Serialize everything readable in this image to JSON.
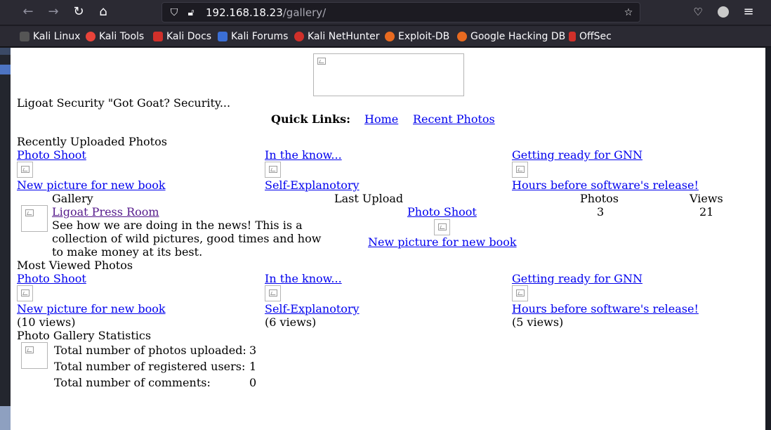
{
  "browser": {
    "url_host": "192.168.18.23",
    "url_path": "/gallery/",
    "bookmarks": [
      {
        "label": "Kali Linux",
        "color": "#3b6fd6"
      },
      {
        "label": "Kali Tools",
        "color": "#e8433a"
      },
      {
        "label": "Kali Docs",
        "color": "#d0302a"
      },
      {
        "label": "Kali Forums",
        "color": "#3b6fd6"
      },
      {
        "label": "Kali NetHunter",
        "color": "#d0302a"
      },
      {
        "label": "Exploit-DB",
        "color": "#e86a20"
      },
      {
        "label": "Google Hacking DB",
        "color": "#e86a20"
      },
      {
        "label": "OffSec",
        "color": "#d0302a"
      }
    ]
  },
  "page": {
    "site_title": "Ligoat Security \"Got Goat? Security...",
    "quick_links_label": "Quick Links:",
    "quick_links": [
      "Home",
      "Recent Photos"
    ],
    "recent_heading": "Recently Uploaded Photos",
    "recent": [
      {
        "album": "Photo Shoot",
        "photo": "New picture for new book"
      },
      {
        "album": "In the know...",
        "photo": "Self-Explanotory"
      },
      {
        "album": "Getting ready for GNN",
        "photo": "Hours before software's release!"
      }
    ],
    "gallery_table": {
      "headers": [
        "Gallery",
        "Last Upload",
        "Photos",
        "Views"
      ],
      "row": {
        "name": "Ligoat Press Room",
        "description": "See how we are doing in the news! This is a collection of wild pictures, good times and how to make money at its best.",
        "last_album": "Photo Shoot",
        "last_photo": "New picture for new book",
        "photos": "3",
        "views": "21"
      }
    },
    "most_viewed_heading": "Most Viewed Photos",
    "most_viewed": [
      {
        "album": "Photo Shoot",
        "photo": "New picture for new book",
        "views": "(10 views)"
      },
      {
        "album": "In the know...",
        "photo": "Self-Explanotory",
        "views": "(6 views)"
      },
      {
        "album": "Getting ready for GNN",
        "photo": "Hours before software's release!",
        "views": "(5 views)"
      }
    ],
    "stats_heading": "Photo Gallery Statistics",
    "stats": [
      {
        "label": "Total number of photos uploaded:",
        "value": "3"
      },
      {
        "label": "Total number of registered users:",
        "value": "1"
      },
      {
        "label": "Total number of comments:",
        "value": "0"
      }
    ]
  }
}
